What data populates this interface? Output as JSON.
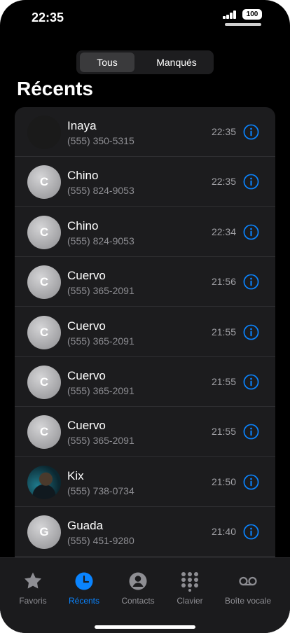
{
  "status_bar": {
    "time": "22:35",
    "battery": "100"
  },
  "segmented": {
    "all": "Tous",
    "missed": "Manqués"
  },
  "page_title": "Récents",
  "calls": [
    {
      "name": "Inaya",
      "number": "(555) 350-5315",
      "time": "22:35",
      "initial": "",
      "avatar": "dark"
    },
    {
      "name": "Chino",
      "number": "(555) 824-9053",
      "time": "22:35",
      "initial": "C",
      "avatar": "initial"
    },
    {
      "name": "Chino",
      "number": "(555) 824-9053",
      "time": "22:34",
      "initial": "C",
      "avatar": "initial"
    },
    {
      "name": "Cuervo",
      "number": "(555) 365-2091",
      "time": "21:56",
      "initial": "C",
      "avatar": "initial"
    },
    {
      "name": "Cuervo",
      "number": "(555) 365-2091",
      "time": "21:55",
      "initial": "C",
      "avatar": "initial"
    },
    {
      "name": "Cuervo",
      "number": "(555) 365-2091",
      "time": "21:55",
      "initial": "C",
      "avatar": "initial"
    },
    {
      "name": "Cuervo",
      "number": "(555) 365-2091",
      "time": "21:55",
      "initial": "C",
      "avatar": "initial"
    },
    {
      "name": "Kix",
      "number": "(555) 738-0734",
      "time": "21:50",
      "initial": "",
      "avatar": "photo"
    },
    {
      "name": "Guada",
      "number": "(555) 451-9280",
      "time": "21:40",
      "initial": "G",
      "avatar": "initial"
    }
  ],
  "tabs": [
    {
      "label": "Favoris",
      "icon": "star-icon",
      "active": false
    },
    {
      "label": "Récents",
      "icon": "clock-icon",
      "active": true
    },
    {
      "label": "Contacts",
      "icon": "person-icon",
      "active": false
    },
    {
      "label": "Clavier",
      "icon": "keypad-icon",
      "active": false
    },
    {
      "label": "Boîte vocale",
      "icon": "voicemail-icon",
      "active": false
    }
  ],
  "colors": {
    "accent": "#0a84ff",
    "background": "#000000",
    "list_bg": "#1c1c1e",
    "secondary_text": "#8e8e93"
  }
}
